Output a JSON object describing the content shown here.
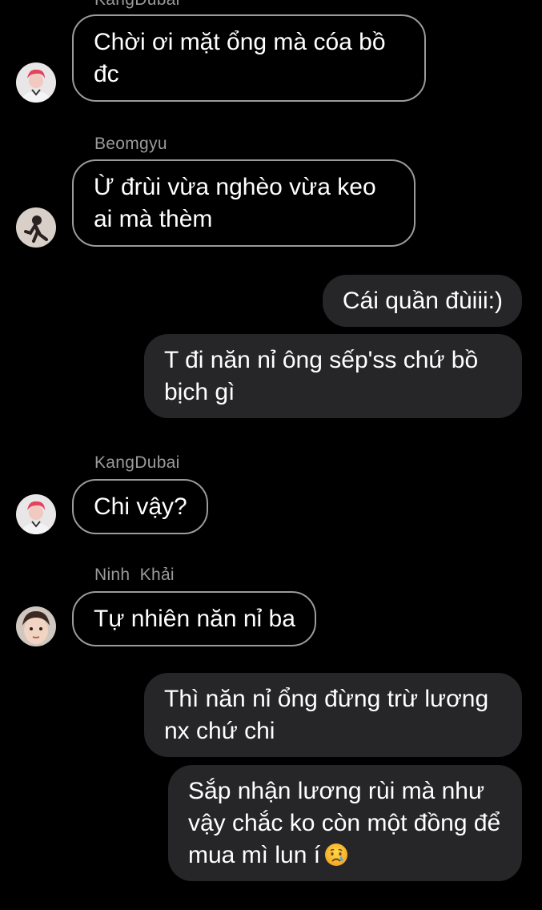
{
  "messages": [
    {
      "sender": "KangDubai",
      "text": "Chời ơi mặt ổng mà cóa bồ đc"
    },
    {
      "sender": "Beomgyu",
      "text": "Ừ đrùi vừa nghèo vừa keo ai mà thèm"
    },
    {
      "text": "Cái quần đùiii:)"
    },
    {
      "text": "T đi năn nỉ ông sếp'ss chứ bồ bịch gì"
    },
    {
      "sender": "KangDubai",
      "text": "Chi vậy?"
    },
    {
      "sender": "Ninh  Khải",
      "text": "Tự nhiên năn nỉ ba"
    },
    {
      "text": "Thì năn nỉ ổng đừng trừ lương nx chứ chi"
    },
    {
      "text": "Sắp nhận lương rùi mà như vậy chắc ko còn một đồng để mua mì lun í",
      "emoji": "crying-face"
    }
  ],
  "colors": {
    "background": "#000000",
    "incoming_border": "#9b9b9b",
    "outgoing_fill": "#262629",
    "sender_name": "#9a9a9a"
  }
}
